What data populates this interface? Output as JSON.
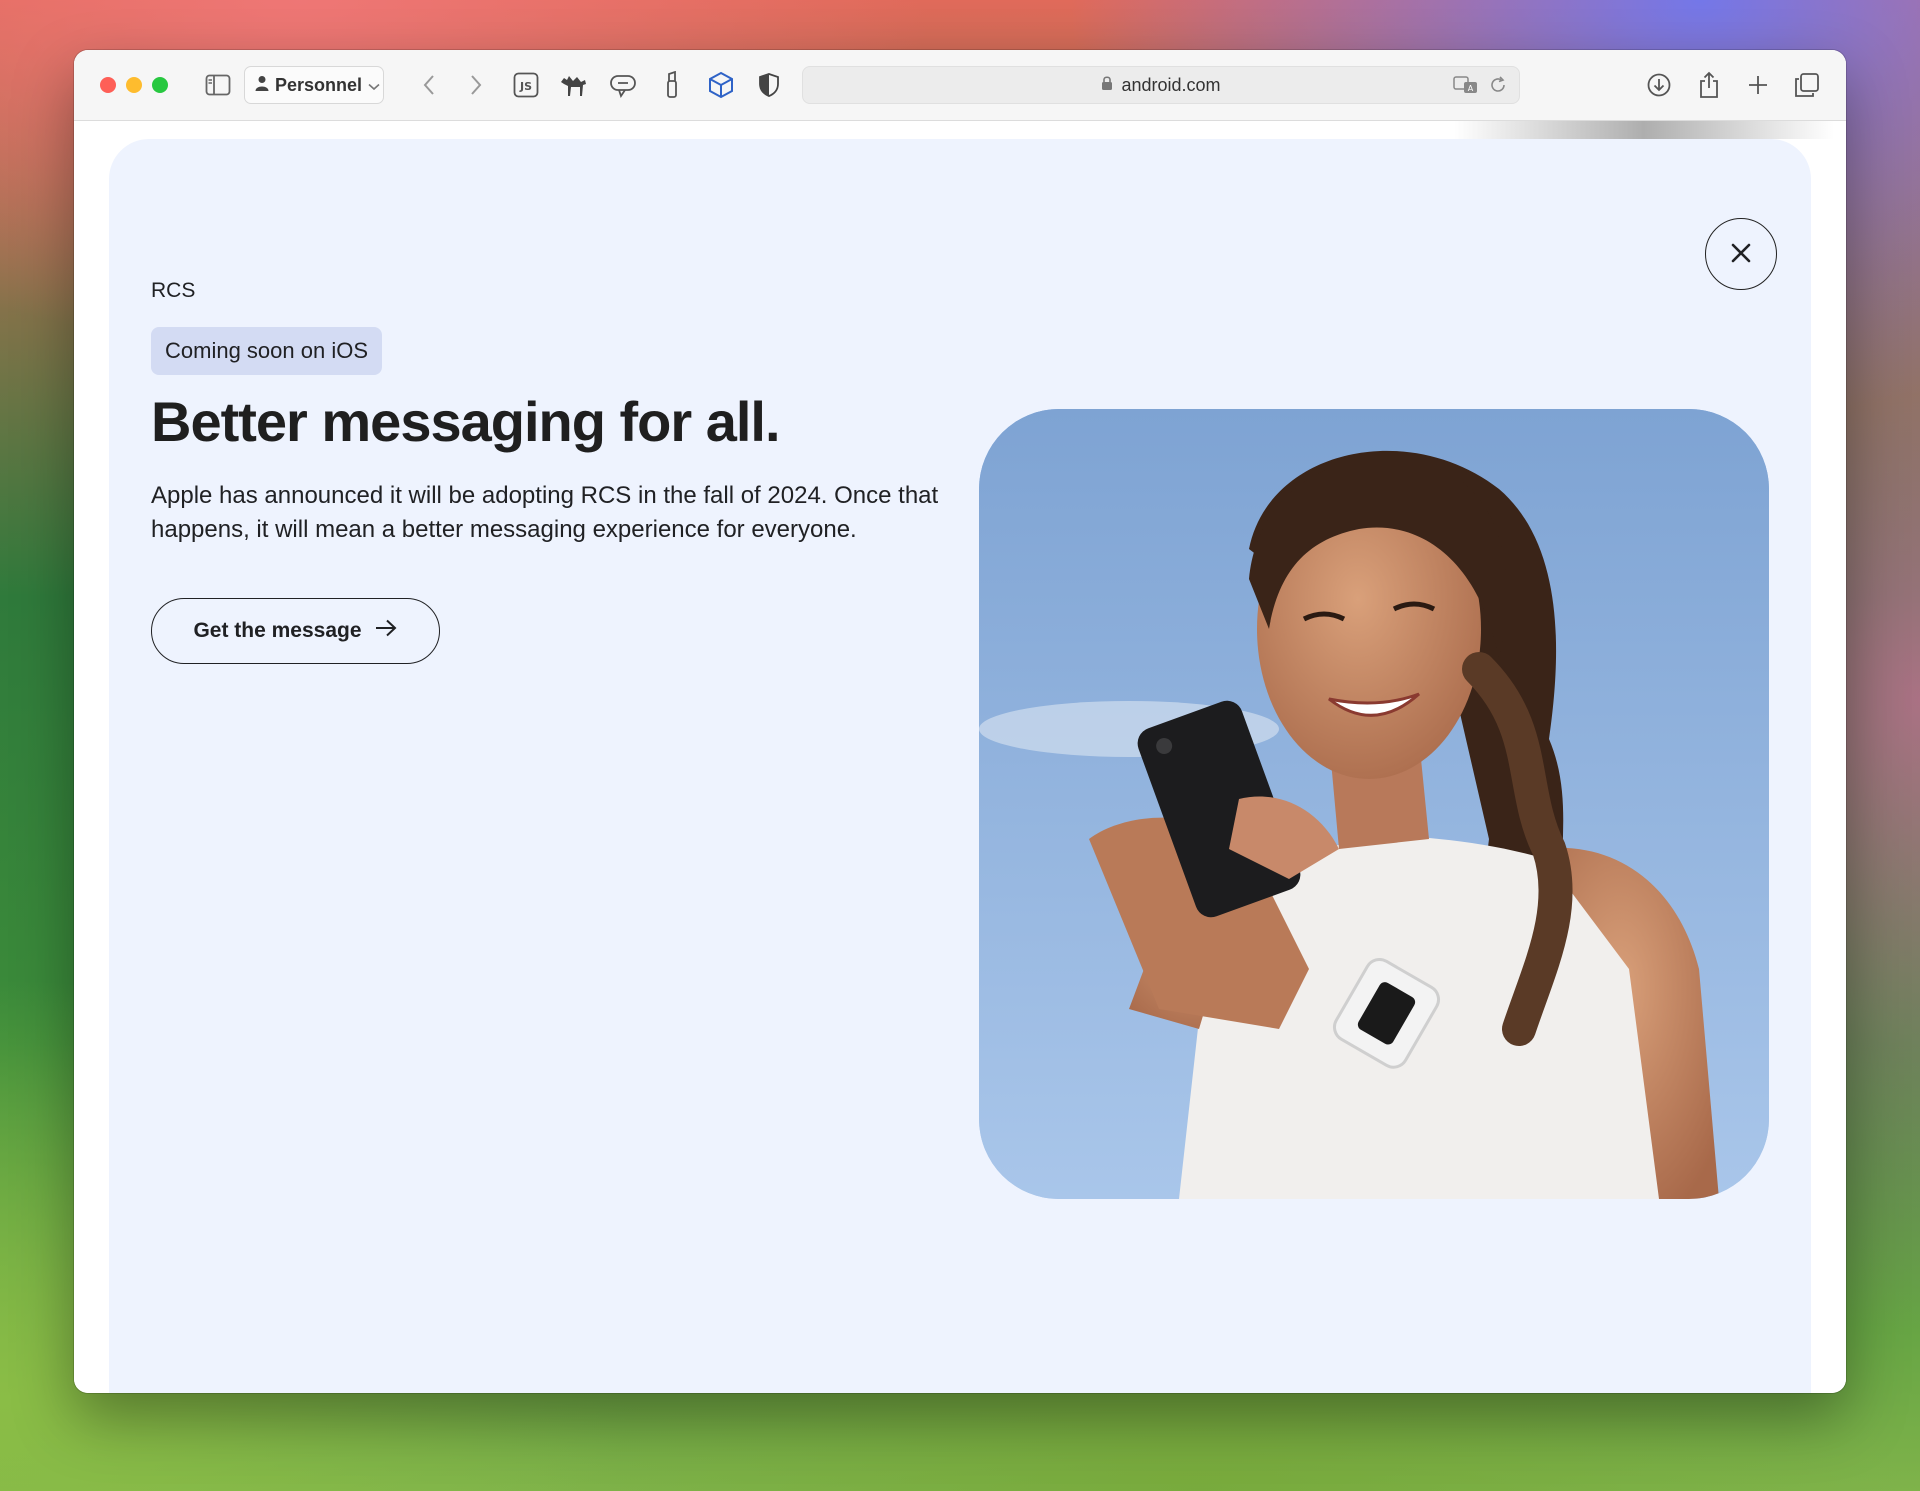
{
  "browser": {
    "profile_label": "Personnel",
    "url": "android.com",
    "toolbar_icons": [
      "sidebar-icon",
      "person-icon",
      "chevron-down-icon",
      "back-icon",
      "forward-icon",
      "js-extension-icon",
      "camel-extension-icon",
      "translate-bubble-extension-icon",
      "tool-extension-icon",
      "cube-extension-icon",
      "shield-extension-icon",
      "lock-icon",
      "translate-icon",
      "reload-icon",
      "download-icon",
      "share-icon",
      "plus-icon",
      "tabs-overview-icon"
    ]
  },
  "page": {
    "eyebrow": "RCS",
    "badge": "Coming soon on iOS",
    "headline": "Better messaging for all.",
    "body": "Apple has announced it will be adopting RCS in the fall of 2024. Once that happens, it will mean a better messaging experience for everyone.",
    "cta_label": "Get the message",
    "close_icon": "close-icon",
    "cta_icon": "arrow-right-icon",
    "image_subject": "woman-smiling-at-phone-photo"
  },
  "colors": {
    "sheet_background": "#eef3fe",
    "badge_background": "#d3dbf3",
    "text": "#202124"
  }
}
